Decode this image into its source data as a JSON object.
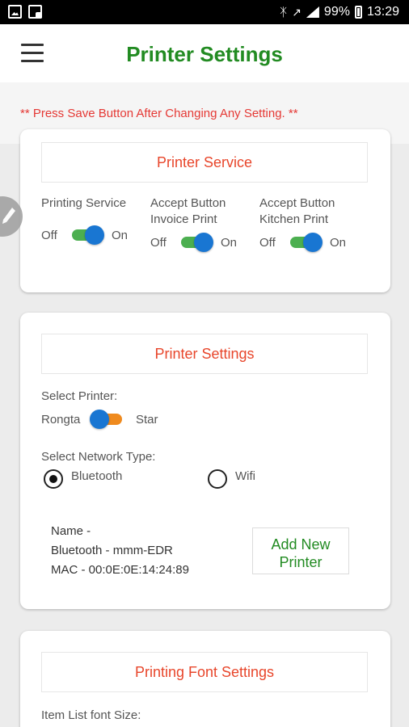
{
  "status_bar": {
    "battery": "99%",
    "time": "13:29",
    "icons": [
      "image-icon",
      "lock-icon",
      "bluetooth-icon",
      "wifi-icon",
      "signal-icon",
      "battery-icon"
    ]
  },
  "header": {
    "title": "Printer Settings",
    "menu_icon": "hamburger-menu-icon"
  },
  "notice": "** Press Save Button After Changing Any Setting. **",
  "printer_service": {
    "heading": "Printer Service",
    "toggles": [
      {
        "label_line1": "Printing Service",
        "label_line2": "",
        "off": "Off",
        "on": "On",
        "state": "on"
      },
      {
        "label_line1": "Accept Button",
        "label_line2": "Invoice Print",
        "off": "Off",
        "on": "On",
        "state": "on"
      },
      {
        "label_line1": "Accept Button",
        "label_line2": "Kitchen Print",
        "off": "Off",
        "on": "On",
        "state": "on"
      }
    ]
  },
  "printer_settings": {
    "heading": "Printer Settings",
    "select_printer_label": "Select Printer:",
    "printer_option_left": "Rongta",
    "printer_option_right": "Star",
    "printer_selected": "Rongta",
    "network_type_label": "Select Network Type:",
    "network_options": [
      "Bluetooth",
      "Wifi"
    ],
    "network_selected": "Bluetooth",
    "device_name": "Name -",
    "device_bluetooth": "Bluetooth - mmm-EDR",
    "device_mac": "MAC - 00:0E:0E:14:24:89",
    "add_button_line1": "Add New",
    "add_button_line2": "Printer"
  },
  "font_settings": {
    "heading": "Printing Font Settings",
    "item_list_label": "Item List font Size:"
  },
  "colors": {
    "accent_green": "#228b22",
    "heading_red": "#e8462b",
    "notice_red": "#e53935",
    "toggle_blue": "#1976d2",
    "toggle_track_green": "#4caf50",
    "toggle_track_orange": "#ef8a1e"
  },
  "floating_button_icon": "pencil-icon"
}
